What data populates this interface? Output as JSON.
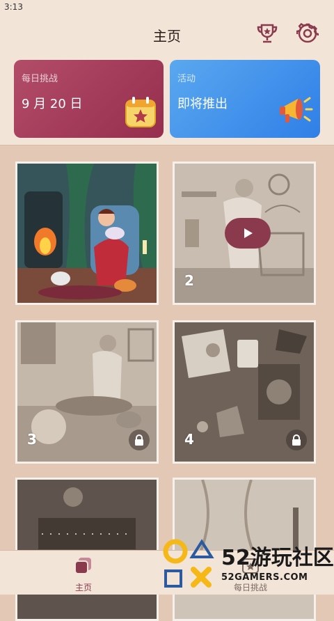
{
  "status": {
    "time": "3:13"
  },
  "header": {
    "title": "主页",
    "trophy_icon": "trophy-icon",
    "settings_icon": "gear-icon",
    "accent": "#8a3a4c"
  },
  "cards": {
    "daily": {
      "label": "每日挑战",
      "value": "9 月 20 日",
      "icon": "calendar-star-icon"
    },
    "event": {
      "label": "活动",
      "value": "即将推出",
      "icon": "megaphone-icon"
    }
  },
  "levels": [
    {
      "number": "",
      "state": "unlocked"
    },
    {
      "number": "2",
      "state": "video"
    },
    {
      "number": "3",
      "state": "locked"
    },
    {
      "number": "4",
      "state": "locked"
    },
    {
      "number": "",
      "state": "partial"
    },
    {
      "number": "",
      "state": "partial"
    }
  ],
  "nav": {
    "home_label": "主页",
    "daily_label": "每日挑战"
  },
  "watermark": {
    "brand": "52游玩社区",
    "site": "52GAMERS.COM"
  }
}
